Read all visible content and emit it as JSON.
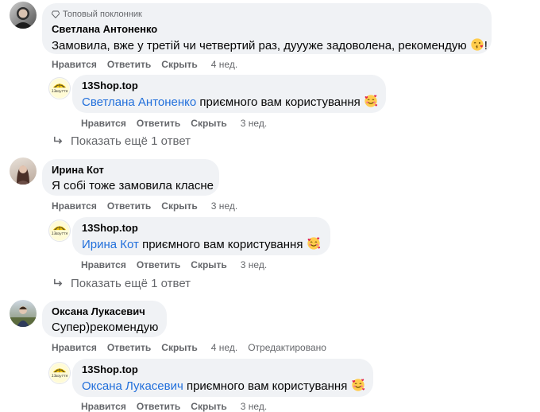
{
  "comments": [
    {
      "badge": "Топовый поклонник",
      "author": "Светлана Антоненко",
      "text": "Замовила, вже у третій чи четвертий раз, дуууже задоволена, рекомендую",
      "text_suffix": "!",
      "actions": {
        "like": "Нравится",
        "reply": "Ответить",
        "hide": "Скрыть",
        "time": "4 нед."
      },
      "reply": {
        "author": "13Shop.top",
        "mention": "Светлана Антоненко",
        "text": " приємного вам користування",
        "actions": {
          "like": "Нравится",
          "reply": "Ответить",
          "hide": "Скрыть",
          "time": "3 нед."
        }
      },
      "more_replies": "Показать ещё 1 ответ"
    },
    {
      "author": "Ирина Кот",
      "text": "Я собі тоже замовила класне",
      "actions": {
        "like": "Нравится",
        "reply": "Ответить",
        "hide": "Скрыть",
        "time": "3 нед."
      },
      "reply": {
        "author": "13Shop.top",
        "mention": "Ирина Кот",
        "text": " приємного вам користування",
        "actions": {
          "like": "Нравится",
          "reply": "Ответить",
          "hide": "Скрыть",
          "time": "3 нед."
        }
      },
      "more_replies": "Показать ещё 1 ответ"
    },
    {
      "author": "Оксана Лукасевич",
      "text": "Супер)рекомендую",
      "actions": {
        "like": "Нравится",
        "reply": "Ответить",
        "hide": "Скрыть",
        "time": "4 нед.",
        "edited": "Отредактировано"
      },
      "reply": {
        "author": "13Shop.top",
        "mention": "Оксана Лукасевич",
        "text": " приємного вам користування",
        "actions": {
          "like": "Нравится",
          "reply": "Ответить",
          "hide": "Скрыть",
          "time": "3 нед."
        }
      }
    }
  ],
  "icons": {
    "badge": "diamond-icon",
    "reply_arrow": "reply-arrow-icon",
    "emoji_kiss": "kissing-face-emoji",
    "emoji_love": "smiling-face-with-hearts-emoji"
  },
  "colors": {
    "bubble_bg": "#f0f2f5",
    "mention": "#216fdb",
    "secondary_text": "#65676b"
  }
}
